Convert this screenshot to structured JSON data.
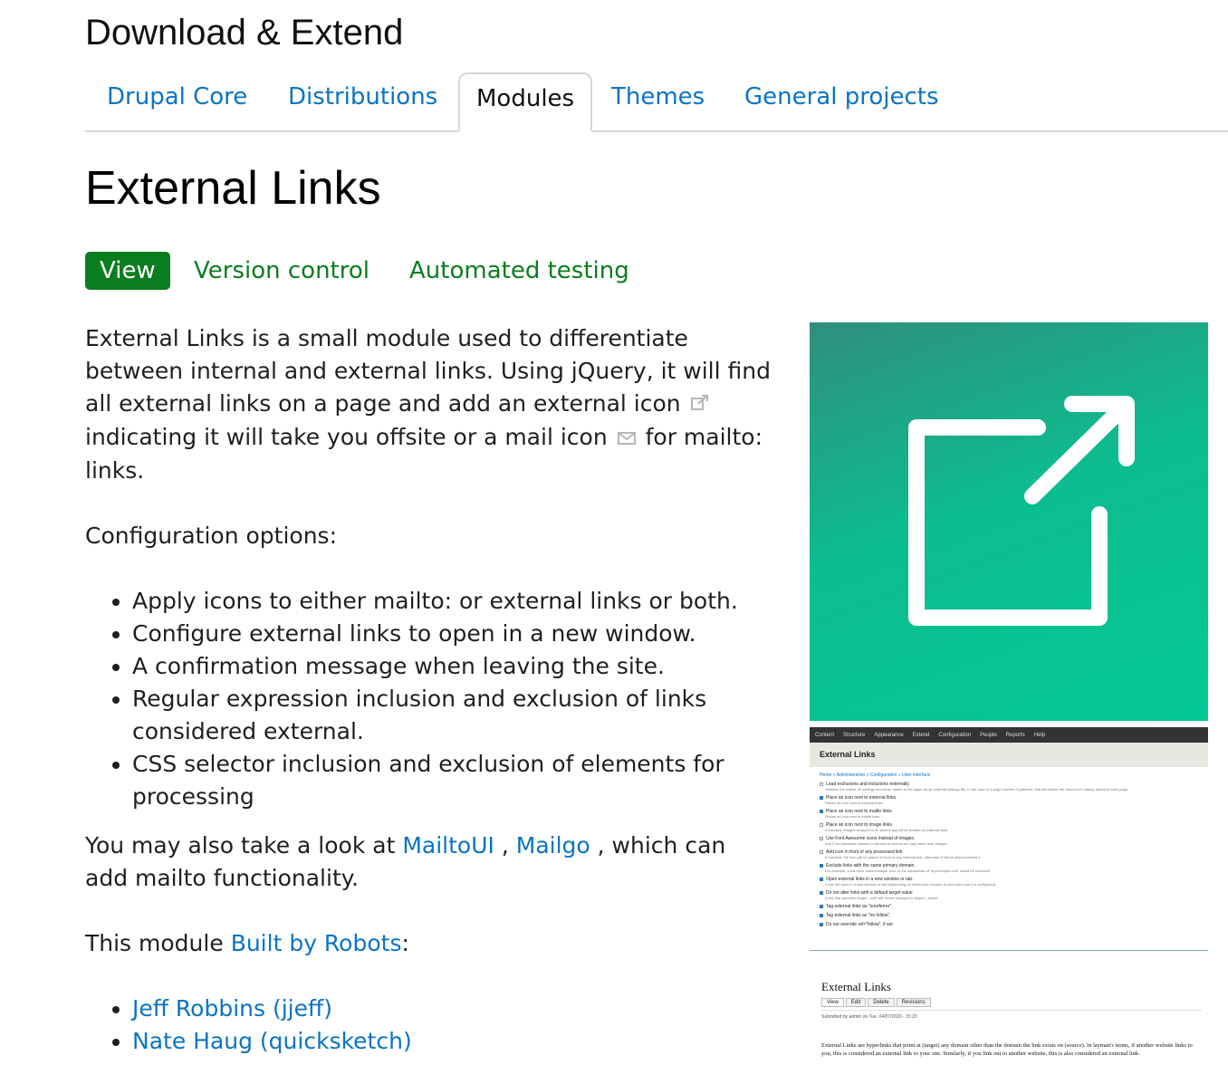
{
  "section_title": "Download & Extend",
  "tabs": [
    {
      "label": "Drupal Core"
    },
    {
      "label": "Distributions"
    },
    {
      "label": "Modules"
    },
    {
      "label": "Themes"
    },
    {
      "label": "General projects"
    }
  ],
  "page_title": "External Links",
  "local_tabs": [
    {
      "label": "View"
    },
    {
      "label": "Version control"
    },
    {
      "label": "Automated testing"
    }
  ],
  "content": {
    "intro_1": "External Links is a small module used to differentiate between internal and external links. Using jQuery, it will find all external links on a page and add an external icon",
    "intro_2": "indicating it will take you offsite or a mail icon",
    "intro_3": "for mailto: links.",
    "config_heading": "Configuration options:",
    "config_items": [
      "Apply icons to either mailto: or external links or both.",
      "Configure external links to open in a new window.",
      "A confirmation message when leaving the site.",
      "Regular expression inclusion and exclusion of links considered external.",
      "CSS selector inclusion and exclusion of elements for processing"
    ],
    "also_prefix": "You may also take a look at",
    "also_link_1": "MailtoUI",
    "also_sep": ",",
    "also_link_2": "Mailgo",
    "also_suffix": ", which can add mailto functionality.",
    "built_prefix": "This module",
    "built_link": "Built by Robots",
    "built_suffix": ":",
    "authors": [
      "Jeff Robbins (jjeff)",
      "Nate Haug (quicksketch)"
    ]
  },
  "screenshot_admin": {
    "toolbar_items": [
      "Content",
      "Structure",
      "Appearance",
      "Extend",
      "Configuration",
      "People",
      "Reports",
      "Help"
    ],
    "title": "External Links",
    "breadcrumb": "Home » Administration » Configuration » User interface",
    "options": [
      {
        "label": "Load exclusions and inclusions externally.",
        "desc": "Whether the extlink JS settings should be added to the page via an external settings file. In the case of a large number of patterns, this will reduce the amount of markup added to each page.",
        "checked": false
      },
      {
        "label": "Place an icon next to external links.",
        "desc": "Places an icon next to external links.",
        "checked": true
      },
      {
        "label": "Place an icon next to mailto links.",
        "desc": "Places an icon next to mailto links.",
        "checked": true
      },
      {
        "label": "Place an icon next to image links.",
        "desc": "If checked, images wrapped in an anchor tag will be treated as external links.",
        "checked": false
      },
      {
        "label": "Use Font Awesome icons instead of images.",
        "desc": "Add Font Awesome classes to the link as well as an i tag rather than images.",
        "checked": false
      },
      {
        "label": "Add icon in front of any processed link",
        "desc": "If checked, the icon will be placed in front of any external link, otherwise it will be placed behind it.",
        "checked": false
      },
      {
        "label": "Exclude links with the same primary domain.",
        "desc": "For example, a link from 'www.example.com' to the subdomain of 'my.example.com' would be excluded.",
        "checked": true
      },
      {
        "label": "Open external links in a new window or tab.",
        "desc": "A link will open in a new window or tab (depending on which web browser is used and how it is configured).",
        "checked": true
      },
      {
        "label": "Do not alter links with a default target value",
        "desc": "A link that specifies target='_self' will not be changed to target='_blank'.",
        "checked": true
      },
      {
        "label": "Tag external links as \"noreferrer\".",
        "desc": "",
        "checked": true
      },
      {
        "label": "Tag external links as \"no follow\".",
        "desc": "",
        "checked": true
      },
      {
        "label": "Do not override rel=\"follow\", if set",
        "desc": "",
        "checked": true
      }
    ]
  },
  "screenshot_node": {
    "title": "External Links",
    "buttons": [
      "View",
      "Edit",
      "Delete",
      "Revisions"
    ],
    "submitted": "Submitted by admin on Tue, 04/07/2020 - 15:20",
    "body": "External Links are hyperlinks that point at (target) any domain other than the domain the link exists on (source). In layman's terms, if another website links to you, this is considered an external link to your site. Similarly, if you link out to another website, this is also considered an external link."
  }
}
